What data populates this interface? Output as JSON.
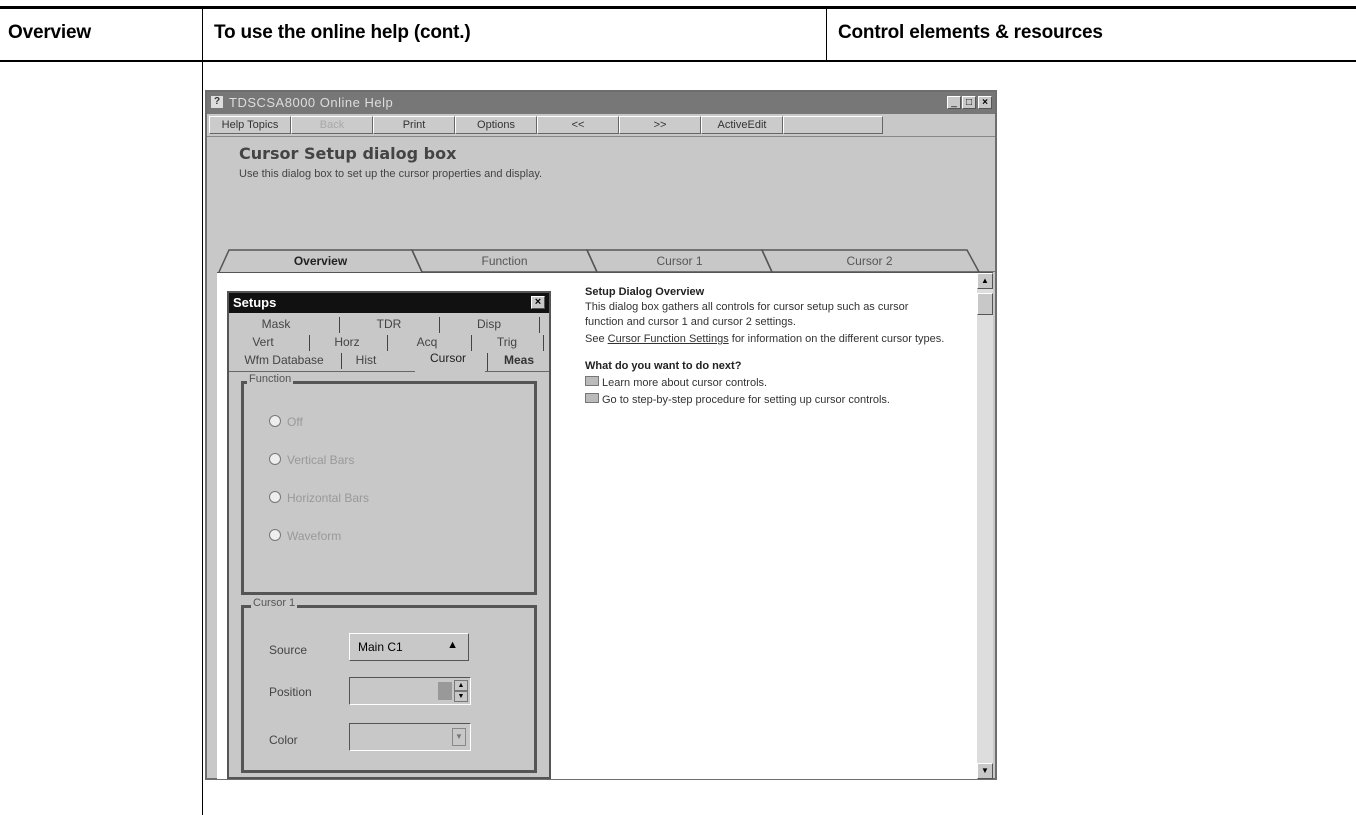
{
  "header": {
    "col1": "Overview",
    "col2": "To use the online help (cont.)",
    "col3": "Control elements & resources"
  },
  "window": {
    "title": "TDSCSA8000 Online Help",
    "toolbar": [
      "Help Topics",
      "Back",
      "Print",
      "Options",
      "<<",
      ">>",
      "ActiveEdit"
    ],
    "topic_title": "Cursor Setup dialog box",
    "topic_desc": "Use this dialog box to set up the cursor properties and display.",
    "tabs": [
      "Overview",
      "Function",
      "Cursor 1",
      "Cursor 2"
    ]
  },
  "setups": {
    "title": "Setups",
    "tabs_row1": [
      "Mask",
      "TDR",
      "Disp"
    ],
    "tabs_row2": [
      "Vert",
      "Horz",
      "Acq",
      "Trig"
    ],
    "tabs_row3": [
      "Wfm Database",
      "Hist",
      "Cursor",
      "Meas"
    ],
    "function": {
      "label": "Function",
      "options": [
        "Off",
        "Vertical Bars",
        "Horizontal Bars",
        "Waveform"
      ]
    },
    "cursor1": {
      "label": "Cursor 1",
      "source_label": "Source",
      "source_value": "Main C1",
      "position_label": "Position",
      "color_label": "Color"
    }
  },
  "help": {
    "heading": "Setup Dialog Overview",
    "body": "This dialog box gathers all controls for cursor setup such as cursor function and cursor 1 and cursor 2 settings.",
    "see_prefix": "See ",
    "see_link": "Cursor Function Settings",
    "see_suffix": " for information on the different cursor types.",
    "next_heading": "What do you want to do next?",
    "next_items": [
      "Learn more about cursor controls.",
      "Go to step-by-step procedure for setting up cursor controls."
    ]
  }
}
